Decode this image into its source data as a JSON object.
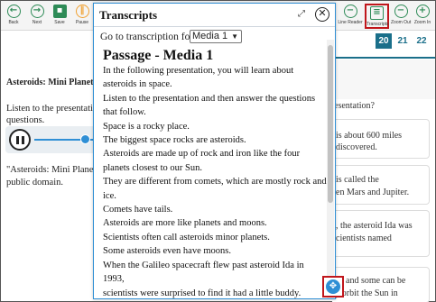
{
  "toolbar": {
    "back": "Back",
    "next": "Next",
    "save": "Save",
    "pause": "Pause",
    "line_reader": "Line Reader",
    "transcripts": "Transcripts",
    "zoom_out": "Zoom Out",
    "zoom_in": "Zoom In"
  },
  "question_tabs": [
    "20",
    "21",
    "22"
  ],
  "active_tab": "20",
  "left_panel": {
    "title": "Asteroids: Mini Planets",
    "instr_1": "Listen to the presentation",
    "instr_2": "questions.",
    "credit_1": "\"Asteroids: Mini Planets",
    "credit_2": "public domain."
  },
  "right_panel": {
    "question": "esentation?",
    "opt_a_1": "is about 600 miles",
    "opt_a_2": "discovered.",
    "opt_b_1": "is called the",
    "opt_b_2": "en Mars and Jupiter.",
    "opt_c_1": ", the asteroid Ida was",
    "opt_c_2": "cientists named",
    "opt_d_1": "and some can be",
    "opt_d_2": "very large with their own moons, they orbit the Sun in"
  },
  "dialog": {
    "title": "Transcripts",
    "goto_label": "Go to transcription for:",
    "selected_media": "Media 1",
    "passage_title": "Passage - Media 1",
    "lines": [
      "In the following presentation, you will learn about",
      "asteroids in space.",
      "Listen to the presentation and then answer the questions",
      "that follow.",
      "Space is a rocky place.",
      "The biggest space rocks are asteroids.",
      "Asteroids are made up of rock and iron like the four",
      "planets closest to our Sun.",
      "They are different from comets, which are mostly rock and",
      "ice.",
      "Comets have tails.",
      "Asteroids are more like planets and moons.",
      "Scientists often call asteroids minor planets.",
      "Some asteroids even have moons.",
      "When the Galileo spacecraft flew past asteroid Ida in",
      "1993,",
      "scientists were surprised to find it had a little buddy."
    ]
  },
  "colors": {
    "accent_green": "#2e8b57",
    "tab_blue": "#1a6f8a",
    "highlight_red": "#c0161b",
    "dialog_border": "#2f8fd5"
  }
}
